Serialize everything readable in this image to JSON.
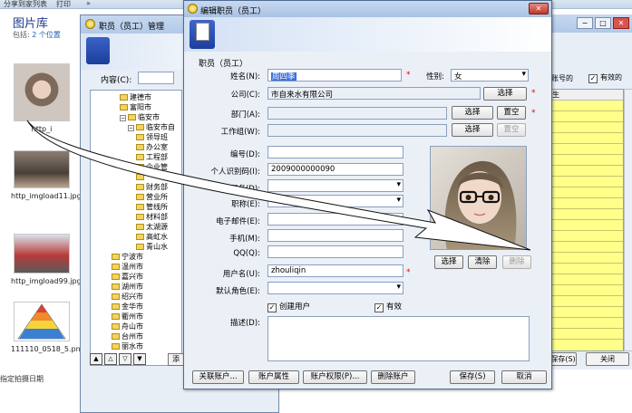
{
  "explorer": {
    "topbar": {
      "left_text": "分享到家列表",
      "mid_text": "打印",
      "chevron": "»"
    },
    "title": "图片库",
    "subtitle_prefix": "包括:",
    "subtitle_link": "2 个位置",
    "thumbnails": [
      {
        "caption": "http_i"
      },
      {
        "caption": "http_imgload11.jpg"
      },
      {
        "caption": "http_imgload99.jpg"
      },
      {
        "caption": "111110_0518_5.png"
      }
    ],
    "footer": "指定拍摄日期"
  },
  "manager": {
    "title": "职员（员工）管理",
    "content_label": "内容(C):",
    "tree": [
      {
        "label": "建德市",
        "level": 2,
        "expander": ""
      },
      {
        "label": "富阳市",
        "level": 2,
        "expander": ""
      },
      {
        "label": "临安市",
        "level": 2,
        "expander": "−"
      },
      {
        "label": "临安市自",
        "level": 3,
        "expander": "−"
      },
      {
        "label": "领导班",
        "level": 4,
        "expander": ""
      },
      {
        "label": "办公室",
        "level": 4,
        "expander": ""
      },
      {
        "label": "工程部",
        "level": 4,
        "expander": ""
      },
      {
        "label": "企业管",
        "level": 4,
        "expander": ""
      },
      {
        "label": "",
        "level": 4,
        "expander": ""
      },
      {
        "label": "财务部",
        "level": 4,
        "expander": ""
      },
      {
        "label": "营业所",
        "level": 4,
        "expander": ""
      },
      {
        "label": "管线所",
        "level": 4,
        "expander": ""
      },
      {
        "label": "材料部",
        "level": 4,
        "expander": ""
      },
      {
        "label": "太湖源",
        "level": 4,
        "expander": ""
      },
      {
        "label": "高虹水",
        "level": 4,
        "expander": ""
      },
      {
        "label": "青山水",
        "level": 4,
        "expander": ""
      },
      {
        "label": "宁波市",
        "level": 1,
        "expander": ""
      },
      {
        "label": "温州市",
        "level": 1,
        "expander": ""
      },
      {
        "label": "嘉兴市",
        "level": 1,
        "expander": ""
      },
      {
        "label": "湖州市",
        "level": 1,
        "expander": ""
      },
      {
        "label": "绍兴市",
        "level": 1,
        "expander": ""
      },
      {
        "label": "金华市",
        "level": 1,
        "expander": ""
      },
      {
        "label": "衢州市",
        "level": 1,
        "expander": ""
      },
      {
        "label": "舟山市",
        "level": 1,
        "expander": ""
      },
      {
        "label": "台州市",
        "level": 1,
        "expander": ""
      },
      {
        "label": "丽水市",
        "level": 1,
        "expander": ""
      }
    ],
    "nav_buttons": [
      "▲",
      "△",
      "▽",
      "▼"
    ],
    "add_button": "添"
  },
  "staff_list": {
    "account_col": "账号的",
    "valid_label": "有效的",
    "grid_head": "生",
    "save_button": "保存(S)",
    "close_button": "关闭"
  },
  "dialog": {
    "title": "编辑职员（员工）",
    "close_glyph": "✕",
    "section": "职员（员工）",
    "fields": {
      "name_label": "姓名(N):",
      "name_value": "周四季",
      "gender_label": "性别:",
      "gender_value": "女",
      "company_label": "公司(C):",
      "company_value": "市自来水有限公司",
      "dept_label": "部门(A):",
      "dept_value": "",
      "workgroup_label": "工作组(W):",
      "workgroup_value": "",
      "code_label": "编号(D):",
      "code_value": "",
      "idnum_label": "个人识别码(I):",
      "idnum_value": "2009000000090",
      "duty_label": "职务(D):",
      "duty_value": "",
      "title_label": "职称(E):",
      "title_value": "",
      "email_label": "电子邮件(E):",
      "email_value": "",
      "mobile_label": "手机(M):",
      "mobile_value": "",
      "qq_label": "QQ(Q):",
      "qq_value": "",
      "username_label": "用户名(U):",
      "username_value": "zhouliqin",
      "role_label": "默认角色(E):",
      "role_value": "",
      "desc_label": "描述(D):"
    },
    "checkboxes": {
      "create_user": "创建用户",
      "valid": "有效",
      "check_mark": "✓"
    },
    "required_mark": "*",
    "buttons": {
      "company_select": "选择",
      "dept_select": "选择",
      "dept_clear": "置空",
      "wg_select": "选择",
      "wg_clear": "置空",
      "photo_select": "选择",
      "photo_clear": "清除",
      "photo_delete": "删除",
      "link_account": "关联账户...",
      "account_props": "账户属性",
      "account_perm": "账户权限(P)...",
      "delete_account": "删除账户",
      "save": "保存(S)",
      "cancel": "取消"
    }
  },
  "colors": {
    "accent": "#3a6fd8",
    "required": "#ee0000",
    "grid_bg": "#ffff8a",
    "dialog_bg": "#ebf0f7"
  }
}
